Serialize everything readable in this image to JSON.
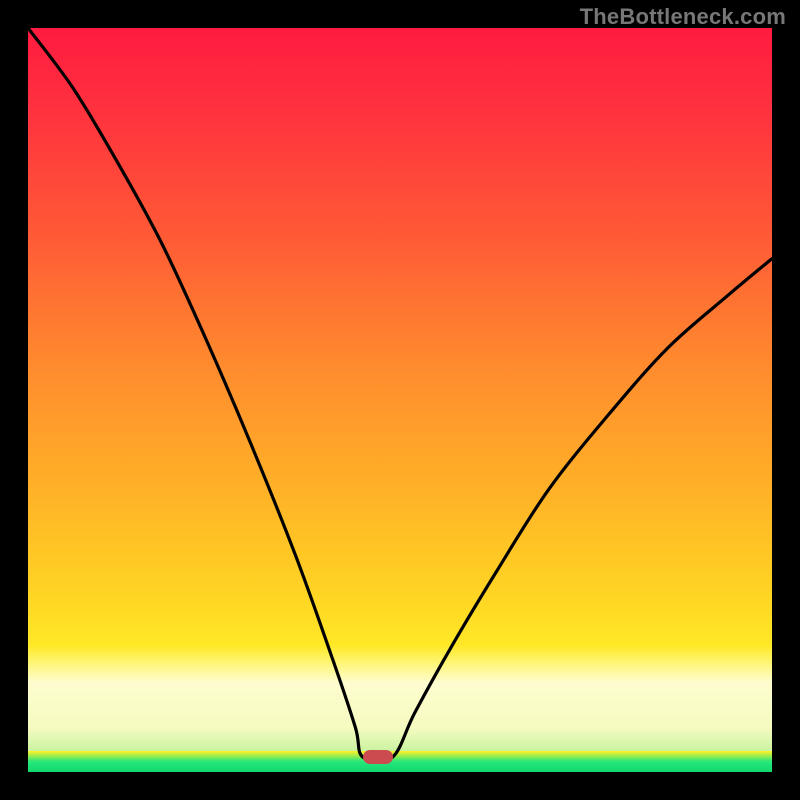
{
  "watermark": "TheBottleneck.com",
  "colors": {
    "frame": "#000000",
    "curve": "#000000",
    "marker": "#cc4b4e",
    "gradient_top": "#ff1b3f",
    "gradient_mid": "#ffd423",
    "gradient_cream": "#fdfccf",
    "gradient_green": "#11d86c"
  },
  "chart_data": {
    "type": "line",
    "title": "",
    "xlabel": "",
    "ylabel": "",
    "xlim": [
      0,
      100
    ],
    "ylim": [
      0,
      100
    ],
    "curve": {
      "left_branch": [
        {
          "x": 0,
          "y": 100
        },
        {
          "x": 6,
          "y": 92
        },
        {
          "x": 12,
          "y": 82
        },
        {
          "x": 18,
          "y": 71
        },
        {
          "x": 24,
          "y": 58
        },
        {
          "x": 30,
          "y": 44
        },
        {
          "x": 36,
          "y": 29
        },
        {
          "x": 41,
          "y": 15
        },
        {
          "x": 44,
          "y": 6
        },
        {
          "x": 45,
          "y": 2
        }
      ],
      "flat_bottom": [
        {
          "x": 45,
          "y": 2
        },
        {
          "x": 49,
          "y": 2
        }
      ],
      "right_branch": [
        {
          "x": 49,
          "y": 2
        },
        {
          "x": 52,
          "y": 8
        },
        {
          "x": 57,
          "y": 17
        },
        {
          "x": 63,
          "y": 27
        },
        {
          "x": 70,
          "y": 38
        },
        {
          "x": 78,
          "y": 48
        },
        {
          "x": 86,
          "y": 57
        },
        {
          "x": 94,
          "y": 64
        },
        {
          "x": 100,
          "y": 69
        }
      ]
    },
    "marker": {
      "x": 47,
      "y": 2
    },
    "background_bands": [
      {
        "name": "red-orange-yellow",
        "from_y": 14,
        "to_y": 100
      },
      {
        "name": "cream",
        "from_y": 3,
        "to_y": 14
      },
      {
        "name": "green",
        "from_y": 0,
        "to_y": 3
      }
    ]
  }
}
